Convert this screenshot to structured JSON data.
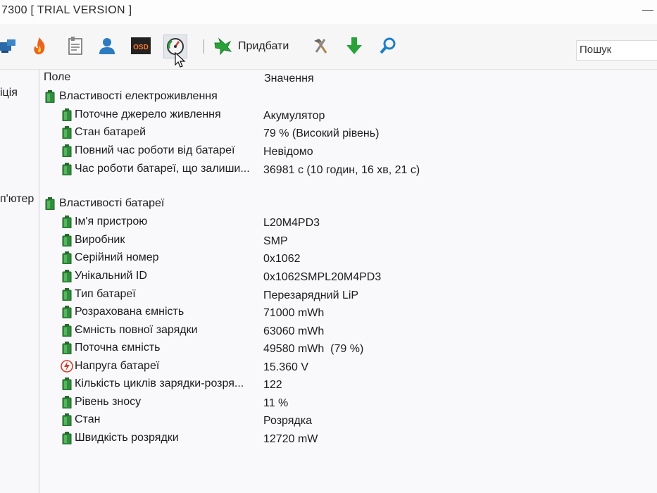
{
  "window": {
    "title": "7300  [ TRIAL VERSION ]"
  },
  "toolbar": {
    "buttons": [
      {
        "name": "network-icon"
      },
      {
        "name": "flame-icon"
      },
      {
        "name": "report-icon"
      },
      {
        "name": "user-icon"
      },
      {
        "name": "osd-icon",
        "text": "OSD"
      },
      {
        "name": "gauge-icon"
      }
    ],
    "add_label": "Придбати",
    "tools": [
      {
        "name": "tools-icon"
      },
      {
        "name": "download-arrow-icon"
      },
      {
        "name": "magnifier-icon"
      }
    ],
    "search_placeholder": "Пошук"
  },
  "sidebar": {
    "items": [
      {
        "label": "іція"
      },
      {
        "label": "п'ютер"
      }
    ]
  },
  "table": {
    "col_field": "Поле",
    "col_value": "Значення",
    "groups": [
      {
        "label": "Властивості електроживлення",
        "rows": [
          {
            "field": "Поточне джерело живлення",
            "value": "Акумулятор"
          },
          {
            "field": "Стан батарей",
            "value": "79 % (Високий рівень)"
          },
          {
            "field": "Повний час роботи від батареї",
            "value": "Невідомо"
          },
          {
            "field": "Час роботи батареї, що залиши...",
            "value": "36981 с (10 годин, 16 хв, 21 с)"
          }
        ]
      },
      {
        "label": "Властивості батареї",
        "rows": [
          {
            "field": "Ім'я пристрою",
            "value": "L20M4PD3"
          },
          {
            "field": "Виробник",
            "value": "SMP"
          },
          {
            "field": "Серійний номер",
            "value": "0x1062"
          },
          {
            "field": "Унікальний ID",
            "value": "0x1062SMPL20M4PD3"
          },
          {
            "field": "Тип батареї",
            "value": "Перезарядний LiP"
          },
          {
            "field": "Розрахована ємність",
            "value": "71000 mWh"
          },
          {
            "field": "Ємність повної зарядки",
            "value": "63060 mWh"
          },
          {
            "field": "Поточна ємність",
            "value": "49580 mWh  (79 %)"
          },
          {
            "field": "Напруга батареї",
            "value": "15.360 V",
            "icon": "voltage"
          },
          {
            "field": "Кількість циклів зарядки-розря...",
            "value": "122"
          },
          {
            "field": "Рівень зносу",
            "value": "11 %"
          },
          {
            "field": "Стан",
            "value": "Розрядка"
          },
          {
            "field": "Швидкість розрядки",
            "value": "12720 mW"
          }
        ]
      }
    ]
  },
  "colors": {
    "battery_green": "#2f8f3a",
    "voltage_red": "#d23a2a",
    "background": "#f9f9fb"
  }
}
